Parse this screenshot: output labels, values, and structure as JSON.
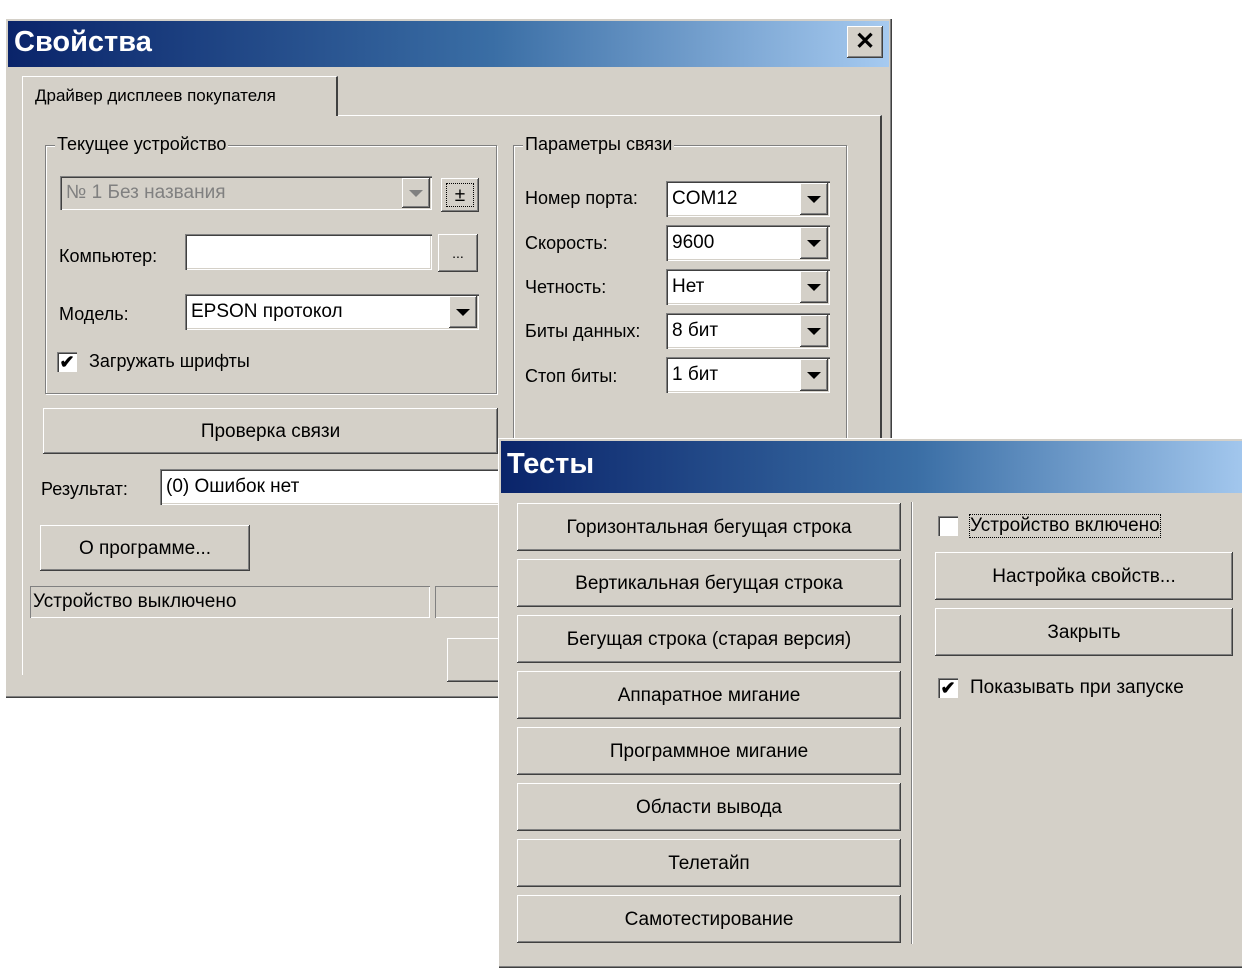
{
  "props": {
    "title": "Свойства",
    "close_glyph": "✕",
    "tab_label": "Драйвер дисплеев покупателя",
    "device_group": {
      "label": "Текущее устройство",
      "device_select": "№ 1 Без названия",
      "plusminus": "±",
      "computer_label": "Компьютер:",
      "computer_value": "",
      "browse": "...",
      "model_label": "Модель:",
      "model_value": "EPSON протокол",
      "load_fonts_label": "Загружать шрифты",
      "load_fonts_checked": "✔"
    },
    "conn_group": {
      "label": "Параметры связи",
      "fields": [
        {
          "label": "Номер порта:",
          "value": "COM12"
        },
        {
          "label": "Скорость:",
          "value": "9600"
        },
        {
          "label": "Четность:",
          "value": "Нет"
        },
        {
          "label": "Биты данных:",
          "value": "8 бит"
        },
        {
          "label": "Стоп биты:",
          "value": "1 бит"
        }
      ]
    },
    "check_conn_button": "Проверка связи",
    "result_label": "Результат:",
    "result_value": "(0) Ошибок нет",
    "about_button": "О программе...",
    "status_text": "Устройство выключено"
  },
  "tests": {
    "title": "Тесты",
    "buttons": [
      "Горизонтальная бегущая строка",
      "Вертикальная бегущая строка",
      "Бегущая строка (старая версия)",
      "Аппаратное мигание",
      "Программное мигание",
      "Области вывода",
      "Телетайп",
      "Самотестирование"
    ],
    "device_on_label": "Устройство включено",
    "device_on_checked": "",
    "settings_button": "Настройка свойств...",
    "close_button": "Закрыть",
    "show_on_start_label": "Показывать при запуске",
    "show_on_start_checked": "✔"
  }
}
